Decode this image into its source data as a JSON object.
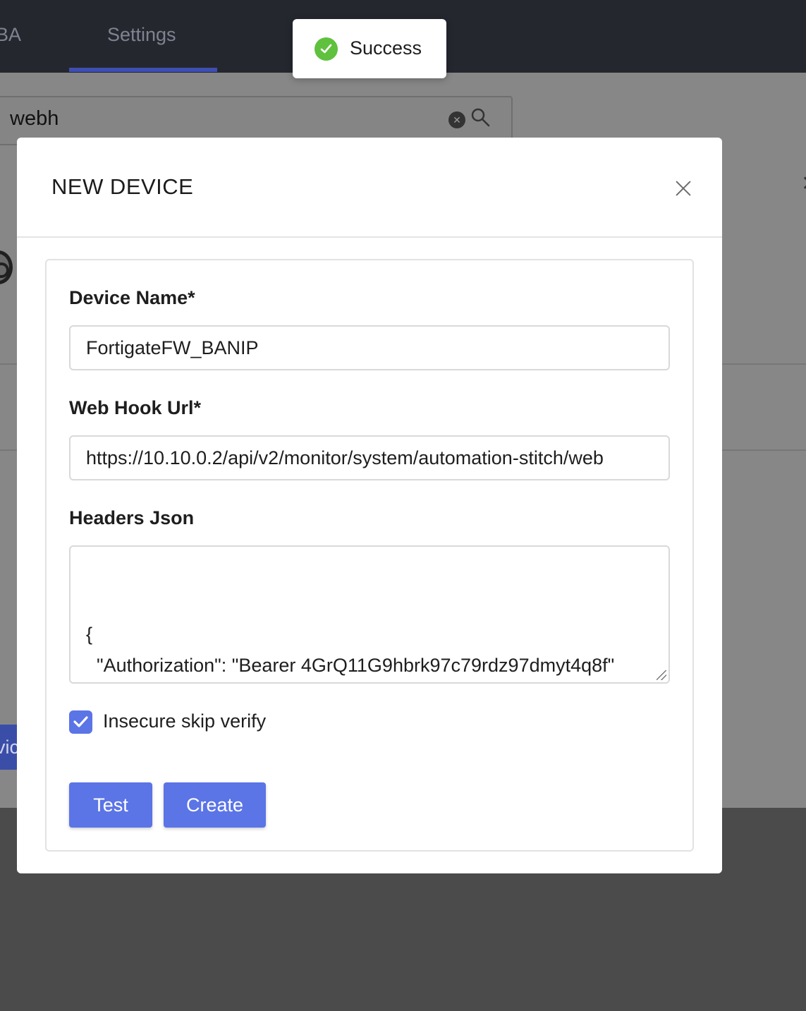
{
  "app": {
    "nav_tabs": [
      "BA",
      "Settings"
    ],
    "search_value": "webh",
    "partial_button_text": "vic"
  },
  "toast": {
    "message": "Success",
    "icon": "check-circle-icon",
    "color": "#5fc13d"
  },
  "modal": {
    "title": "NEW DEVICE",
    "fields": {
      "device_name": {
        "label": "Device Name*",
        "value": "FortigateFW_BANIP"
      },
      "webhook_url": {
        "label": "Web Hook Url*",
        "value": "https://10.10.0.2/api/v2/monitor/system/automation-stitch/web"
      },
      "headers_json": {
        "label": "Headers Json",
        "value": "{\n  \"Authorization\": \"Bearer 4GrQ11G9hbrk97c79rdz97dmyt4q8f\"\n}"
      }
    },
    "insecure_skip_verify": {
      "label": "Insecure skip verify",
      "checked": true
    },
    "buttons": {
      "test": "Test",
      "create": "Create"
    },
    "accent_color": "#5b74e6"
  }
}
